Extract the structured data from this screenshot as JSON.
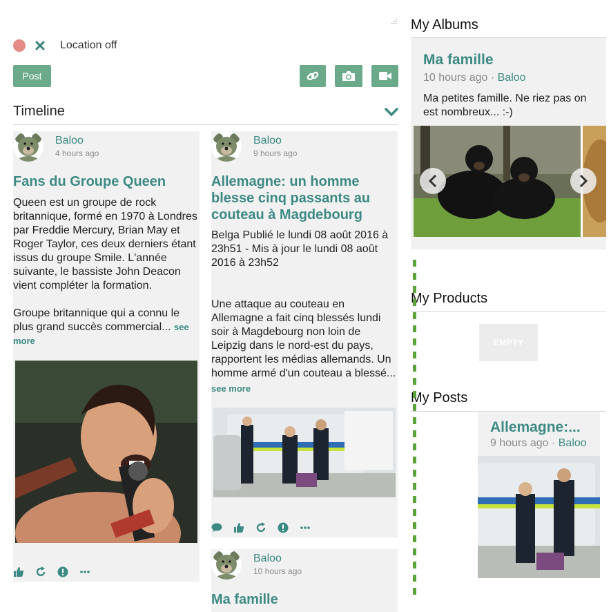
{
  "composer": {
    "location_label": "Location off",
    "post_label": "Post",
    "icons": [
      "close-icon",
      "link-icon",
      "camera-icon",
      "video-icon"
    ]
  },
  "timeline": {
    "title": "Timeline",
    "posts": [
      {
        "author": "Baloo",
        "time": "4 hours ago",
        "title": "Fans du Groupe Queen",
        "body_lines": [
          "Queen est un groupe de rock",
          "britannique, formé en 1970 à Londres",
          "par Freddie Mercury, Brian May et",
          "Roger Taylor, ces deux derniers étant",
          "issus du groupe Smile. L'année",
          "suivante, le bassiste John Deacon",
          "vient compléter la formation.",
          "",
          "Groupe britannique qui a connu le",
          "plus grand succès commercial..."
        ],
        "see_more": "see more"
      },
      {
        "author": "Baloo",
        "time": "9 hours ago",
        "title_lines": [
          "Allemagne: un homme",
          "blesse cinq passants au",
          "couteau à Magdebourg"
        ],
        "body_lines": [
          "Belga Publié le lundi 08 août 2016 à",
          "23h51 - Mis à jour le lundi 08 août",
          "2016 à 23h52",
          "",
          "",
          "Une attaque au couteau en",
          "Allemagne a fait cinq blessés lundi",
          "soir à Magdebourg non loin de",
          "Leipzig dans le nord-est du pays,",
          "rapportent les médias allemands. Un",
          "homme armé d'un couteau a blessé..."
        ],
        "see_more": "see more"
      },
      {
        "author": "Baloo",
        "time": "10 hours ago",
        "title": "Ma famille"
      }
    ]
  },
  "sidebar": {
    "albums": {
      "heading": "My Albums",
      "title": "Ma famille",
      "time": "10 hours ago",
      "separator": "·",
      "author": "Baloo",
      "desc_lines": [
        "Ma petites famille. Ne riez pas on",
        "est nombreux... :-)"
      ]
    },
    "products": {
      "heading": "My Products",
      "empty_label": "EMPTY"
    },
    "posts": {
      "heading": "My Posts",
      "title": "Allemagne:...",
      "time": "9 hours ago",
      "separator": "·",
      "author": "Baloo"
    }
  },
  "colors": {
    "accent": "#3d8a84",
    "button": "#6aaa8a",
    "status_dot": "#e58b86",
    "card_bg": "#f1f1f1"
  }
}
